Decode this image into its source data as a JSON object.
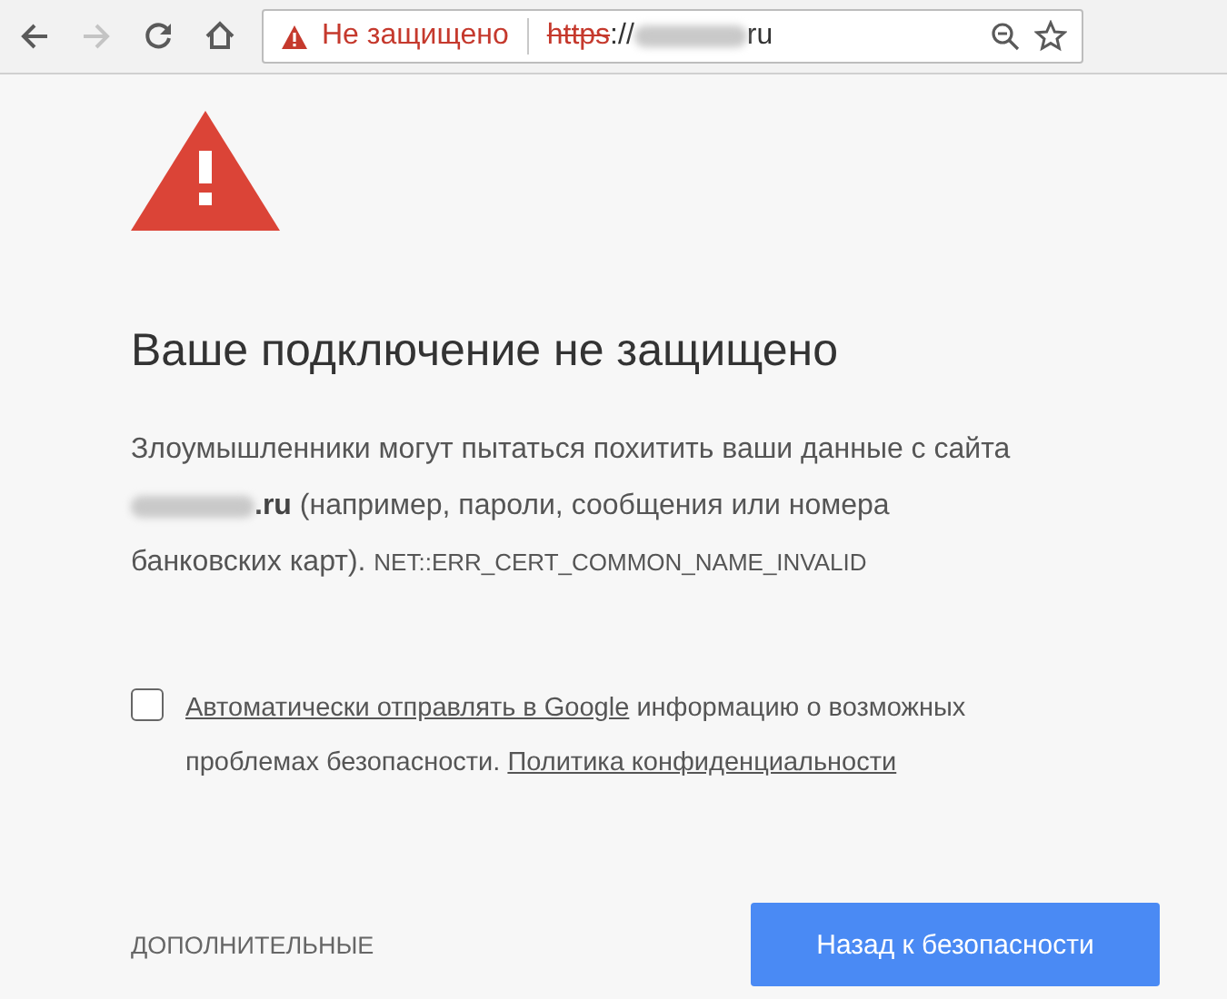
{
  "toolbar": {
    "back_disabled": false,
    "forward_disabled": true
  },
  "address": {
    "security_label": "Не защищено",
    "scheme": "https",
    "separator": "://",
    "tld": "ru",
    "starred": false
  },
  "title": "Ваше подключение не защищено",
  "paragraph": {
    "intro": "Злоумышленники могут пытаться похитить ваши данные с сайта",
    "domain": ".ru",
    "details": "(например, пароли, сообщения или номера банковских карт).",
    "error_code": "NET::ERR_CERT_COMMON_NAME_INVALID"
  },
  "report": {
    "checked": false,
    "link": "Автоматически отправлять в Google",
    "text": "информацию о возможных проблемах безопасности.",
    "policy_link": "Политика конфиденциальности"
  },
  "advanced_button": "ДОПОЛНИТЕЛЬНЫЕ",
  "back_button": "Назад к безопасности"
}
